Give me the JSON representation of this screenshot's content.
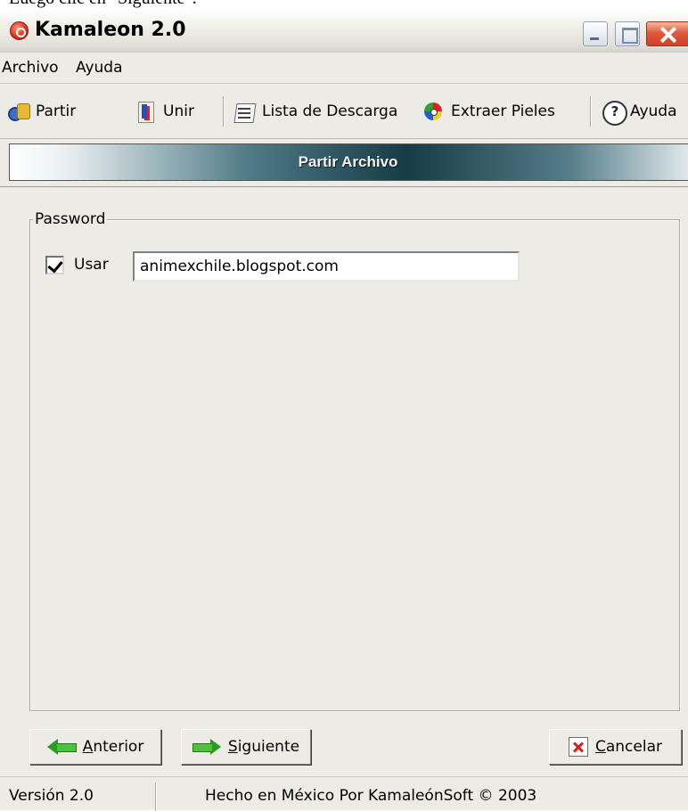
{
  "caption": "Luego clic en \"Siguiente\".",
  "window": {
    "title": "Kamaleon 2.0",
    "icon": "kamaleon-app-icon",
    "controls": [
      "minimize-icon",
      "maximize-icon",
      "close-icon"
    ]
  },
  "menubar": {
    "items": [
      {
        "label": "Archivo"
      },
      {
        "label": "Ayuda"
      }
    ]
  },
  "toolbar": {
    "items": [
      {
        "label": "Partir",
        "icon": "split-icon"
      },
      {
        "label": "Unir",
        "icon": "join-icon"
      },
      {
        "label": "Lista de Descarga",
        "icon": "download-list-icon"
      },
      {
        "label": "Extraer Pieles",
        "icon": "extract-skins-icon"
      },
      {
        "label": "Ayuda",
        "icon": "help-icon"
      }
    ]
  },
  "section": {
    "title": "Partir Archivo"
  },
  "password_group": {
    "legend": "Password",
    "checkbox_label": "Usar",
    "checked": true,
    "value": "animexchile.blogspot.com"
  },
  "buttons": {
    "back": {
      "mnemonic": "A",
      "rest": "nterior",
      "icon": "green-left-arrow-icon"
    },
    "next": {
      "mnemonic": "S",
      "rest": "iguiente",
      "icon": "green-right-arrow-icon"
    },
    "cancel": {
      "mnemonic": "C",
      "rest": "ancelar",
      "icon": "cancel-x-icon"
    }
  },
  "statusbar": {
    "version": "Versión 2.0",
    "credits": "Hecho en México Por KamaleónSoft © 2003"
  },
  "colors": {
    "chrome_background": "#ecebe5",
    "banner_dark": "#173b47",
    "close_button": "#e05a3a",
    "arrow_green": "#4cc23c"
  }
}
